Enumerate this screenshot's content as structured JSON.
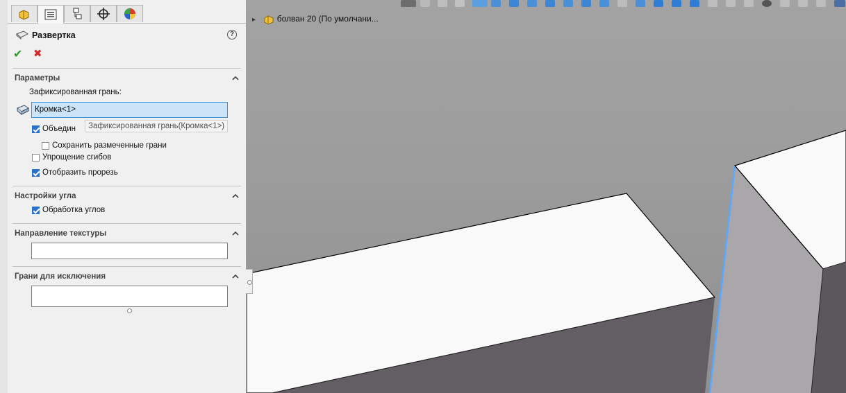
{
  "feature": {
    "title": "Развертка",
    "ok_label": "✔",
    "cancel_label": "✖",
    "help_label": "?"
  },
  "tabs": [
    "feature-manager",
    "property-manager",
    "configuration-manager",
    "dimxpert-manager",
    "display-manager"
  ],
  "sections": {
    "params": {
      "title": "Параметры",
      "fixed_face_label": "Зафиксированная грань:",
      "fixed_face_value": "Кромка<1>",
      "tooltip": "Зафиксированная грань(Кромка<1>)",
      "merge_faces_label": "Объедин",
      "keep_marked_faces_label": "Сохранить размеченные грани",
      "simplify_bends_label": "Упрощение сгибов",
      "show_cut_label": "Отобразить прорезь"
    },
    "corner": {
      "title": "Настройки угла",
      "corner_treatment_label": "Обработка углов"
    },
    "texture": {
      "title": "Направление текстуры",
      "value": ""
    },
    "exclude": {
      "title": "Грани для исключения",
      "value": ""
    }
  },
  "checkbox_states": {
    "merge_faces": true,
    "keep_marked_faces": false,
    "simplify_bends": false,
    "show_cut": true,
    "corner_treatment": true
  },
  "viewport": {
    "tree_expand": "▸",
    "tree_part_label": "болван 20 (По умолчани..."
  },
  "colors": {
    "accept": "#2e9a2e",
    "cancel": "#d22a2a",
    "checkbox": "#2a72c8",
    "selected_edge": "#5aa8ff",
    "input_highlight": "#cce4f7"
  }
}
